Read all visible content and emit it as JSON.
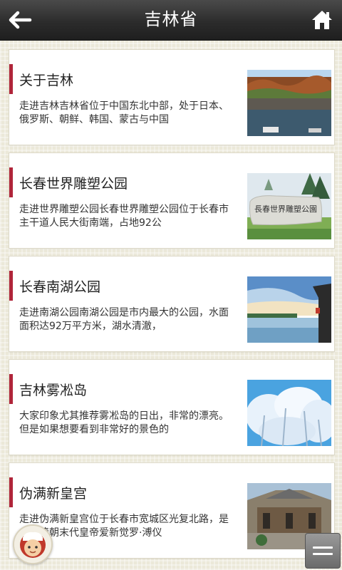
{
  "header": {
    "title": "吉林省"
  },
  "icons": {
    "back": "back-arrow-icon",
    "home": "home-icon",
    "assistant": "chef-avatar-icon",
    "menu": "menu-icon"
  },
  "colors": {
    "topbar": "#2c2c2c",
    "accent_bar": "#b0253a",
    "background": "#ebe8d9"
  },
  "items": [
    {
      "title": "关于吉林",
      "desc": "走进吉林吉林省位于中国东北中部，处于日本、俄罗斯、朝鲜、韩国、蒙古与中国"
    },
    {
      "title": "长春世界雕塑公园",
      "desc": "走进世界雕塑公园长春世界雕塑公园位于长春市主干道人民大街南端，占地92公"
    },
    {
      "title": "长春南湖公园",
      "desc": "走进南湖公园南湖公园是市内最大的公园，水面面积达92万平方米，湖水清澈，"
    },
    {
      "title": "吉林雾凇岛",
      "desc": "大家印象尤其推荐雾凇岛的日出，非常的漂亮。但是如果想要看到非常好的景色的"
    },
    {
      "title": "伪满新皇宫",
      "desc": "走进伪满新皇宫位于长春市宽城区光复北路，是中国清朝末代皇帝爱新觉罗·溥仪"
    }
  ]
}
